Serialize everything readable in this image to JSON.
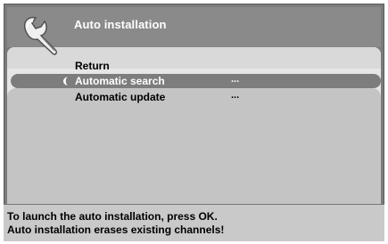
{
  "header": {
    "title": "Auto installation"
  },
  "menu": {
    "items": [
      {
        "label": "Return",
        "value": ""
      },
      {
        "label": "Automatic search",
        "value": "...",
        "selected": true
      },
      {
        "label": "Automatic update",
        "value": "..."
      }
    ]
  },
  "footer": {
    "line1": "To launch the auto installation, press OK.",
    "line2": "Auto installation erases existing channels!"
  },
  "colors": {
    "frame": "#7b7b7b",
    "header": "#8a8a8a",
    "selected_row": "#7d7d7d",
    "panel": "#c4c4c4",
    "footer": "#c9c9c9"
  },
  "icons": {
    "header_icon": "wrench-icon",
    "cursor_icon": "selection-cursor-icon"
  }
}
